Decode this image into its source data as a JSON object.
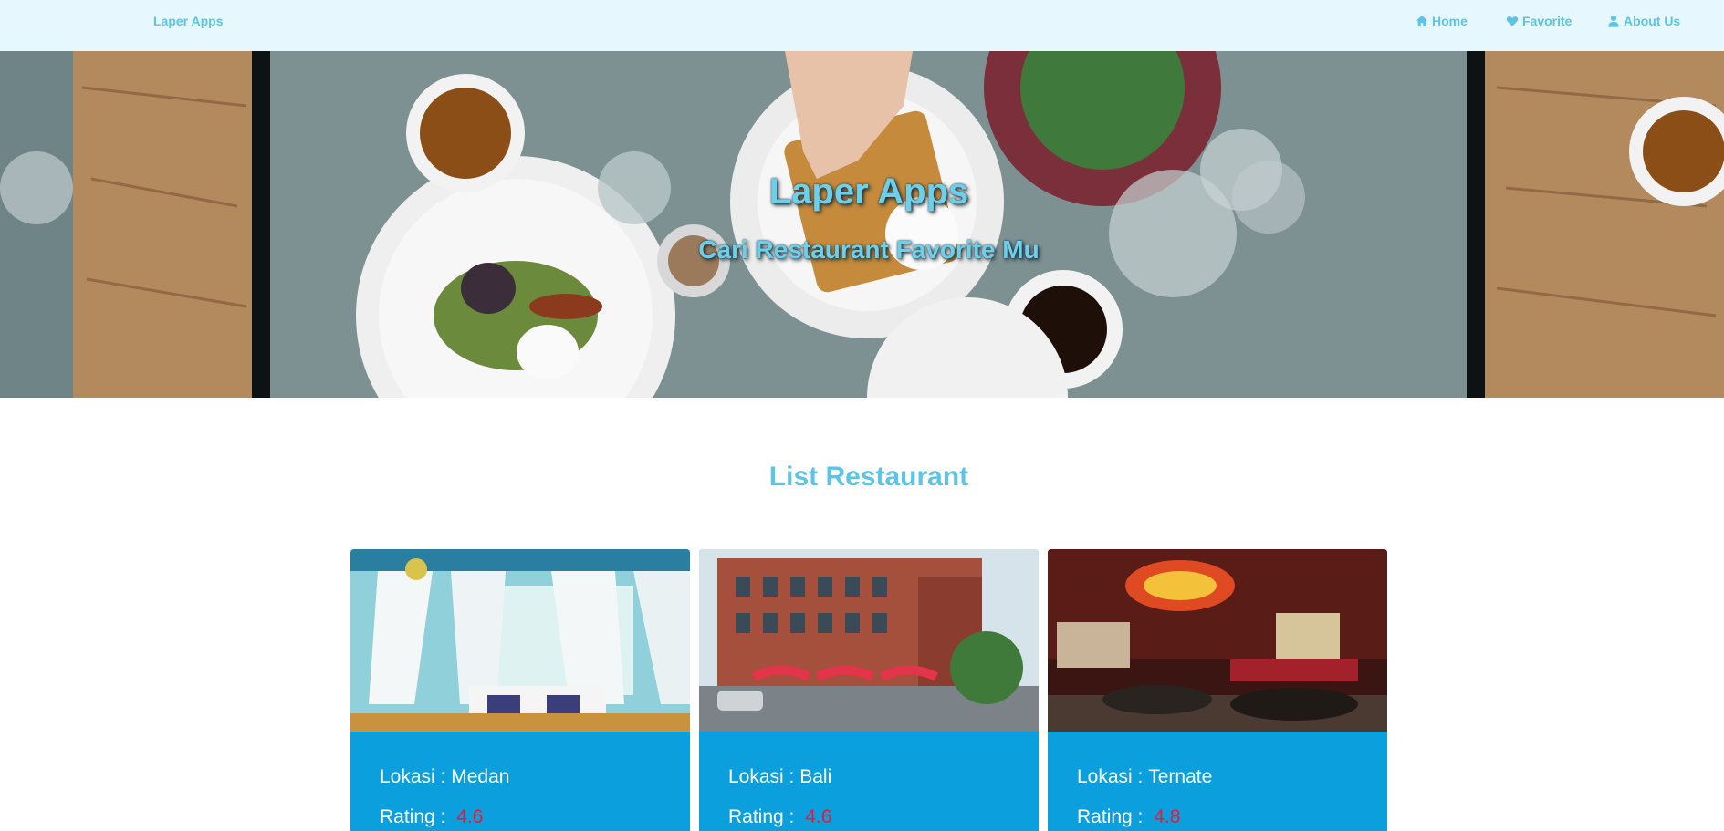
{
  "navbar": {
    "brand": "Laper Apps",
    "links": [
      {
        "label": "Home",
        "icon": "home-icon"
      },
      {
        "label": "Favorite",
        "icon": "heart-icon"
      },
      {
        "label": "About Us",
        "icon": "user-icon"
      }
    ]
  },
  "hero": {
    "title": "Laper Apps",
    "subtitle": "Cari Restaurant Favorite Mu"
  },
  "main": {
    "section_title": "List Restaurant",
    "restaurants": [
      {
        "location_label": "Lokasi : ",
        "location": "Medan",
        "rating_label": "Rating : ",
        "rating": "4.6"
      },
      {
        "location_label": "Lokasi : ",
        "location": "Bali",
        "rating_label": "Rating : ",
        "rating": "4.6"
      },
      {
        "location_label": "Lokasi : ",
        "location": "Ternate",
        "rating_label": "Rating : ",
        "rating": "4.8"
      }
    ]
  },
  "colors": {
    "accent": "#5dc4e4",
    "navbar_bg": "#e6f8fd",
    "card_bg": "#0b9fdd",
    "rating": "#e8183a"
  }
}
